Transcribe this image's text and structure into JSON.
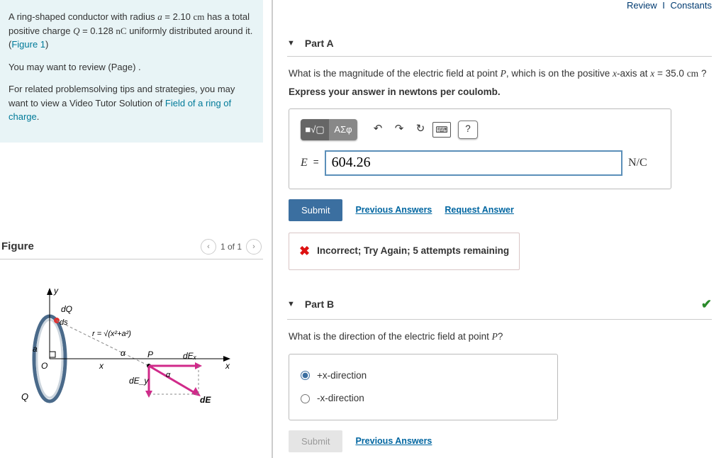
{
  "topLinks": {
    "review": "Review",
    "sep": "I",
    "constants": "Constants"
  },
  "info": {
    "line1a": "A ring-shaped conductor with radius ",
    "var_a": "a",
    "eq": " = 2.10 ",
    "unit_cm": "cm",
    "line1b": " has a total positive charge ",
    "var_Q": "Q",
    "eq2": " = 0.128 ",
    "unit_nC": "nC",
    "line1c": " uniformly distributed around it.(",
    "figlink": "Figure 1",
    "line1d": ")",
    "line2": "You may want to review (Page) .",
    "line3a": "For related problemsolving tips and strategies, you may want to view a Video Tutor Solution of ",
    "line3link": "Field of a ring of charge",
    "line3b": "."
  },
  "figure": {
    "title": "Figure",
    "counter": "1 of 1",
    "labels": {
      "y": "y",
      "dQ": "dQ",
      "ds": "ds",
      "r": "r = √(x²+a²)",
      "a": "a",
      "O": "O",
      "x": "x",
      "alpha": "α",
      "P": "P",
      "dEx": "dEₓ",
      "dEy": "dE_y",
      "dE": "dE",
      "Q": "Q"
    }
  },
  "partA": {
    "title": "Part A",
    "q1": "What is the magnitude of the electric field at point ",
    "var_P": "P",
    "q2": ", which is on the positive ",
    "var_x": "x",
    "q3": "-axis at ",
    "var_x2": "x",
    "eq": " = 35.0 ",
    "unit_cm": "cm",
    "q4": " ?",
    "instruct": "Express your answer in newtons per coulomb.",
    "toolbar": {
      "t1": "■√▢",
      "t2": "ΑΣφ",
      "undo": "↶",
      "redo": "↷",
      "reset": "↻",
      "kb": "⌨",
      "help": "?"
    },
    "var_E": "E",
    "equals": "=",
    "value": "604.26",
    "unit": "N/C",
    "submit": "Submit",
    "prev": "Previous Answers",
    "req": "Request Answer",
    "feedback": "Incorrect; Try Again; 5 attempts remaining"
  },
  "partB": {
    "title": "Part B",
    "q1": "What is the direction of the electric field at point ",
    "var_P": "P",
    "q2": "?",
    "opt1": "+x-direction",
    "opt2": "-x-direction",
    "submit": "Submit",
    "prev": "Previous Answers"
  }
}
